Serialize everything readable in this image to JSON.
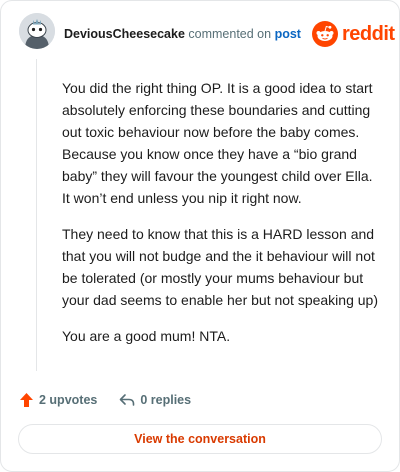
{
  "header": {
    "username": "DeviousCheesecake",
    "action_text": "commented on",
    "link_text": "post",
    "brand": "reddit"
  },
  "comment": {
    "paragraphs": [
      "You did the right thing OP. It is a good idea to start absolutely enforcing these boundaries and cutting out toxic behaviour now before the baby comes. Because you know once they have a “bio grand baby” they will favour the youngest child over Ella. It won’t end unless you nip it right now.",
      "They need to know that this is a HARD lesson and that you will not budge and the it behaviour will not be tolerated (or mostly your mums behaviour but your dad seems to enable her but not speaking up)",
      "You are a good mum! NTA."
    ]
  },
  "stats": {
    "upvotes": "2 upvotes",
    "replies": "0 replies"
  },
  "footer": {
    "button_label": "View the conversation"
  },
  "colors": {
    "accent": "#ff4500",
    "upvote": "#ff4500",
    "link": "#0a66c2",
    "button_text": "#d93a00"
  },
  "icons": {
    "avatar": "snoo-avatar",
    "brand": "reddit-snoo-icon",
    "upvote": "upvote-arrow-icon",
    "reply": "reply-arrow-icon"
  }
}
